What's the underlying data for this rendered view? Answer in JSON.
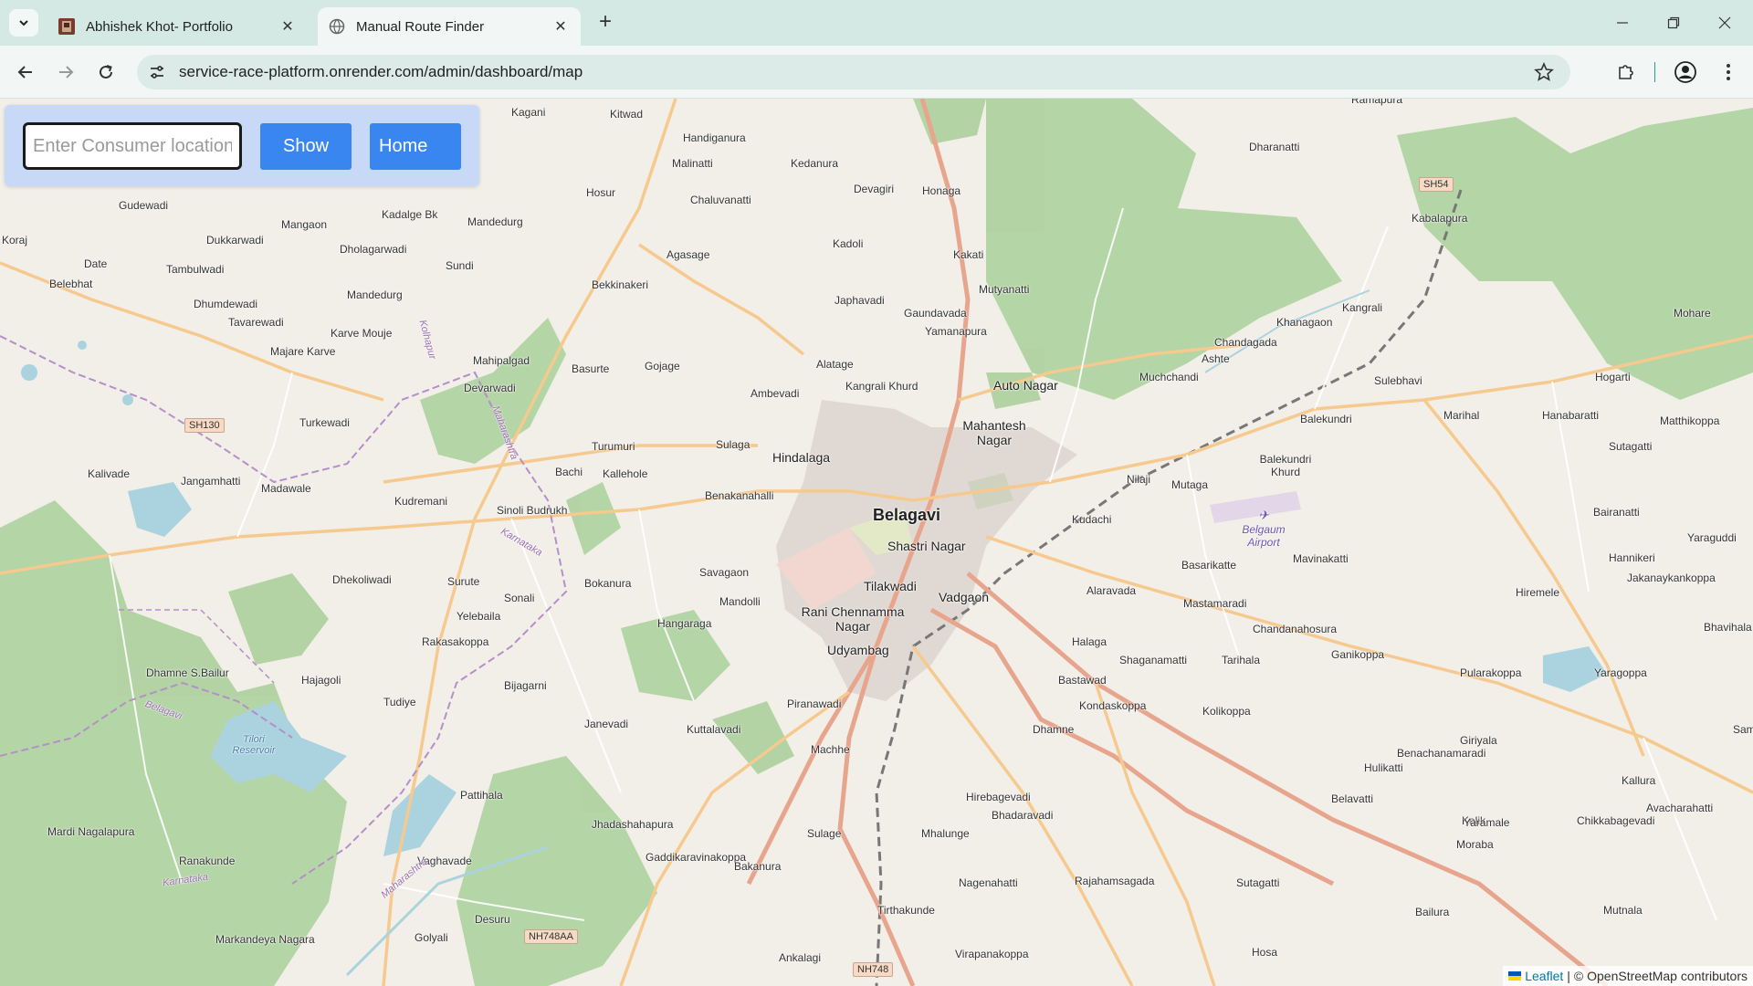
{
  "browser": {
    "tabs": [
      {
        "title": "Abhishek Khot- Portfolio",
        "active": false
      },
      {
        "title": "Manual Route Finder",
        "active": true
      }
    ],
    "url": "service-race-platform.onrender.com/admin/dashboard/map"
  },
  "panel": {
    "input_placeholder": "Enter Consumer location",
    "show_label": "Show",
    "home_label": "Home",
    "button_color": "#3a86f0"
  },
  "map": {
    "city": "Belagavi",
    "places": [
      {
        "name": "Kagani"
      },
      {
        "name": "Kitwad"
      },
      {
        "name": "Handiganura"
      },
      {
        "name": "Malinatti"
      },
      {
        "name": "Kedanura"
      },
      {
        "name": "Devagiri"
      },
      {
        "name": "Honaga"
      },
      {
        "name": "Dharanatti"
      },
      {
        "name": "Ramapura"
      },
      {
        "name": "Hosur"
      },
      {
        "name": "Chaluvanatti"
      },
      {
        "name": "Kabalapura"
      },
      {
        "name": "Gudewadi"
      },
      {
        "name": "Kadalge Bk"
      },
      {
        "name": "Mandedurg"
      },
      {
        "name": "Mangaon"
      },
      {
        "name": "Dukkarwadi"
      },
      {
        "name": "Dholagarwadi"
      },
      {
        "name": "Agasage"
      },
      {
        "name": "Kadoli"
      },
      {
        "name": "Kakati"
      },
      {
        "name": "Koraj"
      },
      {
        "name": "Date"
      },
      {
        "name": "Tambulwadi"
      },
      {
        "name": "Sundi"
      },
      {
        "name": "Belebhat"
      },
      {
        "name": "Bekkinakeri"
      },
      {
        "name": "Mutyanatti"
      },
      {
        "name": "Kangrali"
      },
      {
        "name": "Dhumdewadi"
      },
      {
        "name": "Mandedurg"
      },
      {
        "name": "Japhavadi"
      },
      {
        "name": "Gaundavada"
      },
      {
        "name": "Khanagaon"
      },
      {
        "name": "Mohare"
      },
      {
        "name": "Tavarewadi"
      },
      {
        "name": "Yamanapura"
      },
      {
        "name": "Chandagada"
      },
      {
        "name": "Karve Mouje"
      },
      {
        "name": "Ashte"
      },
      {
        "name": "Majare Karve"
      },
      {
        "name": "Mahipalgad"
      },
      {
        "name": "Basurte"
      },
      {
        "name": "Gojage"
      },
      {
        "name": "Alatage"
      },
      {
        "name": "Muchchandi"
      },
      {
        "name": "Hogarti"
      },
      {
        "name": "Devarwadi"
      },
      {
        "name": "Auto Nagar"
      },
      {
        "name": "Sulebhavi"
      },
      {
        "name": "Kangrali Khurd"
      },
      {
        "name": "Ambevadi"
      },
      {
        "name": "Mahantesh Nagar"
      },
      {
        "name": "Marihal"
      },
      {
        "name": "Hanabaratti"
      },
      {
        "name": "Matthikoppa"
      },
      {
        "name": "Turkewadi"
      },
      {
        "name": "Balekundri"
      },
      {
        "name": "Sutagatti"
      },
      {
        "name": "Turumuri"
      },
      {
        "name": "Sulaga"
      },
      {
        "name": "Hindalaga"
      },
      {
        "name": "Kalivade"
      },
      {
        "name": "Jangamhatti"
      },
      {
        "name": "Bachi"
      },
      {
        "name": "Kallehole"
      },
      {
        "name": "Balekundri Khurd"
      },
      {
        "name": "Nilaji"
      },
      {
        "name": "Mutaga"
      },
      {
        "name": "Madawale"
      },
      {
        "name": "Benakanahalli"
      },
      {
        "name": "Kudremani"
      },
      {
        "name": "Sinoli Budrukh"
      },
      {
        "name": "Kudachi"
      },
      {
        "name": "Bairanatti"
      },
      {
        "name": "Yaraguddi"
      },
      {
        "name": "Shastri Nagar"
      },
      {
        "name": "Hannikeri"
      },
      {
        "name": "Basarikatte"
      },
      {
        "name": "Mavinakatti"
      },
      {
        "name": "Dhekoliwadi"
      },
      {
        "name": "Surute"
      },
      {
        "name": "Bokanura"
      },
      {
        "name": "Savagaon"
      },
      {
        "name": "Tilakwadi"
      },
      {
        "name": "Jakanaykankoppa"
      },
      {
        "name": "Sonali"
      },
      {
        "name": "Alaravada"
      },
      {
        "name": "Hiremele"
      },
      {
        "name": "Mandolli"
      },
      {
        "name": "Vadgaon"
      },
      {
        "name": "Mastamaradi"
      },
      {
        "name": "Yelebaila"
      },
      {
        "name": "Rani Chennamma Nagar"
      },
      {
        "name": "Bhavihala"
      },
      {
        "name": "Hangaraga"
      },
      {
        "name": "Chandanahosura"
      },
      {
        "name": "Rakasakoppa"
      },
      {
        "name": "Halaga"
      },
      {
        "name": "Shaganamatti"
      },
      {
        "name": "Tarihala"
      },
      {
        "name": "Ganikoppa"
      },
      {
        "name": "Udyambag"
      },
      {
        "name": "Dhamne S.Bailur"
      },
      {
        "name": "Hajagoli"
      },
      {
        "name": "Bastawad"
      },
      {
        "name": "Pularakoppa"
      },
      {
        "name": "Yaragoppa"
      },
      {
        "name": "Bijagarni"
      },
      {
        "name": "Tudiye"
      },
      {
        "name": "Kondaskoppa"
      },
      {
        "name": "Piranawadi"
      },
      {
        "name": "Janevadi"
      },
      {
        "name": "Kolikoppa"
      },
      {
        "name": "Kuttalavadi"
      },
      {
        "name": "Dhamne"
      },
      {
        "name": "Sampag"
      },
      {
        "name": "Giriyala"
      },
      {
        "name": "Machhe"
      },
      {
        "name": "Hulikatti"
      },
      {
        "name": "Benachanamaradi"
      },
      {
        "name": "Kallura"
      },
      {
        "name": "Belavatti"
      },
      {
        "name": "Hirebagevadi"
      },
      {
        "name": "Avacharahatti"
      },
      {
        "name": "Pattihala"
      },
      {
        "name": "Kolik"
      },
      {
        "name": "Bhadaravadi"
      },
      {
        "name": "Yaramale"
      },
      {
        "name": "Chikkabagevadi"
      },
      {
        "name": "Mardi Nagalapura"
      },
      {
        "name": "Jhadashahapura"
      },
      {
        "name": "Sulage"
      },
      {
        "name": "Mhalunge"
      },
      {
        "name": "Moraba"
      },
      {
        "name": "Ranakunde"
      },
      {
        "name": "Vaghavade"
      },
      {
        "name": "Gaddikaravinakoppa"
      },
      {
        "name": "Bakanura"
      },
      {
        "name": "Sutagatti"
      },
      {
        "name": "Nagenahatti"
      },
      {
        "name": "Rajahamsagada"
      },
      {
        "name": "Mutnala"
      },
      {
        "name": "Bailura"
      },
      {
        "name": "Desuru"
      },
      {
        "name": "Tirthakunde"
      },
      {
        "name": "Golyali"
      },
      {
        "name": "Markandeya Nagara"
      },
      {
        "name": "Ankalagi"
      },
      {
        "name": "Virapanakoppa"
      },
      {
        "name": "Hosa"
      }
    ],
    "states": [
      "Maharashtra",
      "Karnataka",
      "Maharashtra",
      "Karnataka",
      "Kolhapur",
      "Belagavi"
    ],
    "waters": [
      "Tilori Reservoir"
    ],
    "airport": "Belgaum Airport",
    "shields": [
      "SH130",
      "SH54",
      "NH748AA",
      "NH748"
    ]
  },
  "attribution": {
    "leaflet": "Leaflet",
    "separator": "|",
    "osm": "© OpenStreetMap contributors"
  },
  "colors": {
    "tabbar": "#d5e9e4",
    "panel": "#c7d9f7",
    "map_bg": "#f2efe9",
    "forest": "#add19e",
    "water": "#aad3df",
    "trunk_road": "#e8a58d",
    "primary_road": "#f6c98e"
  }
}
